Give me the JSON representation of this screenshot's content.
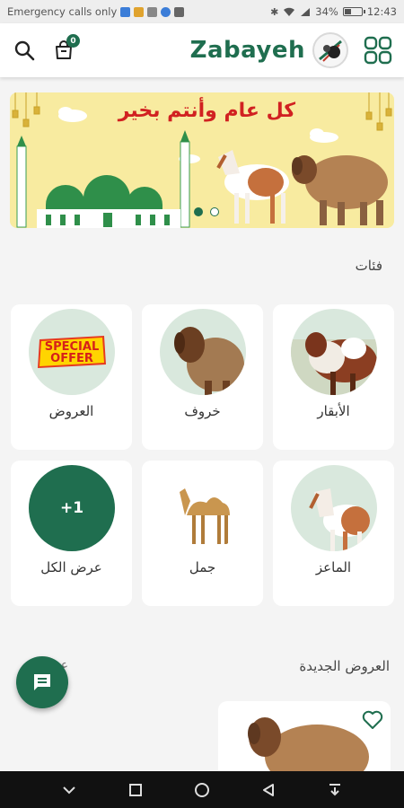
{
  "status_bar": {
    "carrier_text": "Emergency calls only",
    "battery_text": "34%",
    "battery_level": 0.34,
    "time": "12:43"
  },
  "header": {
    "brand": "Zabayeh",
    "cart_count": "0",
    "icons": {
      "search": "search-icon",
      "cart": "cart-icon",
      "menu": "grid-menu-icon"
    }
  },
  "banner": {
    "title": "كل عام وأنتم بخير",
    "slide_count": 2,
    "active_slide": 1
  },
  "categories": {
    "title": "فئات",
    "items": [
      {
        "label": "الأبقار"
      },
      {
        "label": "خروف"
      },
      {
        "label": "العروض",
        "badge_line1": "SPECIAL",
        "badge_line2": "OFFER"
      },
      {
        "label": "الماعز"
      },
      {
        "label": "جمل"
      },
      {
        "label": "عرض الكل",
        "circle_text": "+1"
      }
    ]
  },
  "new_offers": {
    "title": "العروض الجديدة",
    "view_all": "عر"
  },
  "colors": {
    "accent": "#1f6e4f",
    "banner_bg": "#f8eba0",
    "banner_title": "#d12121",
    "circle_bg": "#d9e8dd"
  }
}
